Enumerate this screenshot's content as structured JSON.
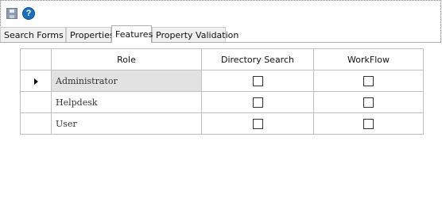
{
  "toolbar": {
    "save_icon": "save-icon",
    "help_icon": "help-icon",
    "help_glyph": "?"
  },
  "tabs": [
    {
      "label": "Search Forms",
      "active": false
    },
    {
      "label": "Properties",
      "active": false
    },
    {
      "label": "Features",
      "active": true
    },
    {
      "label": "Property Validation",
      "active": false
    }
  ],
  "grid": {
    "columns": [
      "",
      "Role",
      "Directory Search",
      "WorkFlow"
    ],
    "rows": [
      {
        "role": "Administrator",
        "selected": true,
        "directory_search": false,
        "workflow": false
      },
      {
        "role": "Helpdesk",
        "selected": false,
        "directory_search": false,
        "workflow": false
      },
      {
        "role": "User",
        "selected": false,
        "directory_search": false,
        "workflow": false
      }
    ]
  }
}
